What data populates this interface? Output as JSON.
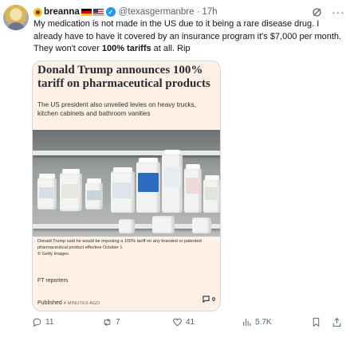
{
  "tweet": {
    "display_name": "breanna",
    "handle": "@texasgermanbre",
    "separator": "·",
    "time": "17h",
    "text_before": "My medication is not made in the US due to it being a rare disease drug. I already have to have it covered by an insurance program it's $7,000 per month. They won't cover ",
    "text_bold": "100% tariffs",
    "text_after": " at all. Rip",
    "icons": [
      "sunflower-icon",
      "german-flag-icon",
      "us-flag-icon",
      "verified-badge-icon",
      "grok-icon",
      "more-icon"
    ]
  },
  "card": {
    "headline": "Donald Trump announces 100% tariff on pharmaceutical products",
    "standfirst": "The US president also unveiled levies on heavy trucks, kitchen cabinets and bathroom vanities",
    "caption": "Donald Trump said he would be imposing a 100% tariff on any branded or patented pharmaceutical product effective October 1",
    "credit": "© Getty Images",
    "author": "FT reporters",
    "published_label": "Published",
    "published_ago": "4 MINUTES AGO",
    "comment_count": "0",
    "background_color": "#fff1e5"
  },
  "actions": {
    "replies": "11",
    "reposts": "7",
    "likes": "41",
    "views": "5.7K"
  }
}
